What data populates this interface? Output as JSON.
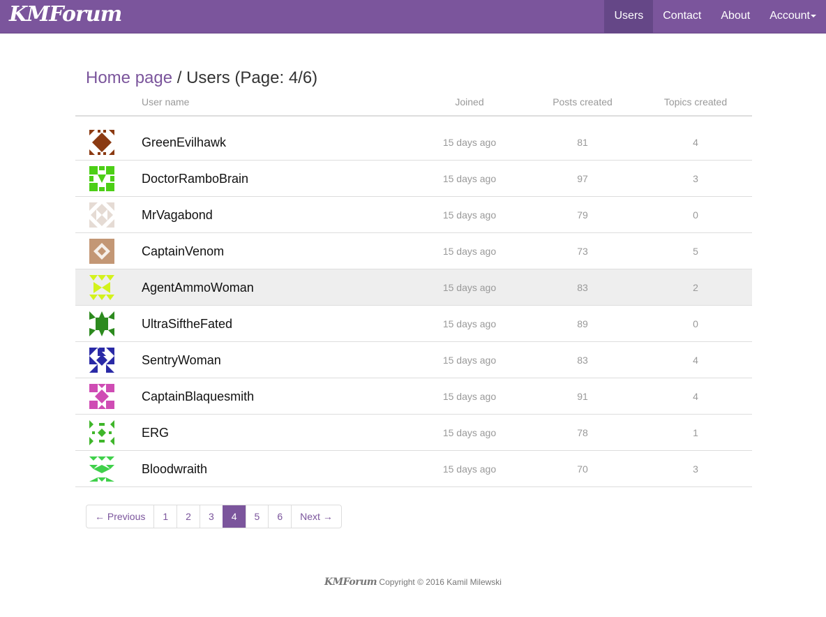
{
  "navbar": {
    "brand": "KMForum",
    "items": [
      {
        "label": "Users",
        "active": true
      },
      {
        "label": "Contact",
        "active": false
      },
      {
        "label": "About",
        "active": false
      },
      {
        "label": "Account",
        "active": false
      }
    ]
  },
  "breadcrumb": {
    "home": "Home page",
    "separator": " / ",
    "current": "Users (Page: 4/6)"
  },
  "table": {
    "headers": {
      "user_name": "User name",
      "joined": "Joined",
      "posts": "Posts created",
      "topics": "Topics created"
    },
    "rows": [
      {
        "name": "GreenEvilhawk",
        "joined": "15 days ago",
        "posts": "81",
        "topics": "4",
        "color": "#8b3a12"
      },
      {
        "name": "DoctorRamboBrain",
        "joined": "15 days ago",
        "posts": "97",
        "topics": "3",
        "color": "#4ccf16"
      },
      {
        "name": "MrVagabond",
        "joined": "15 days ago",
        "posts": "79",
        "topics": "0",
        "color": "#e5dbd4"
      },
      {
        "name": "CaptainVenom",
        "joined": "15 days ago",
        "posts": "73",
        "topics": "5",
        "color": "#c39775"
      },
      {
        "name": "AgentAmmoWoman",
        "joined": "15 days ago",
        "posts": "83",
        "topics": "2",
        "color": "#d3f21c"
      },
      {
        "name": "UltraSiftheFated",
        "joined": "15 days ago",
        "posts": "89",
        "topics": "0",
        "color": "#2c8a1e"
      },
      {
        "name": "SentryWoman",
        "joined": "15 days ago",
        "posts": "83",
        "topics": "4",
        "color": "#2a2aa6"
      },
      {
        "name": "CaptainBlaquesmith",
        "joined": "15 days ago",
        "posts": "91",
        "topics": "4",
        "color": "#cf4cb4"
      },
      {
        "name": "ERG",
        "joined": "15 days ago",
        "posts": "78",
        "topics": "1",
        "color": "#3fb62a"
      },
      {
        "name": "Bloodwraith",
        "joined": "15 days ago",
        "posts": "70",
        "topics": "3",
        "color": "#3fd04a"
      }
    ]
  },
  "pagination": {
    "previous": "← Previous",
    "pages": [
      "1",
      "2",
      "3",
      "4",
      "5",
      "6"
    ],
    "active_page": "4",
    "next": "Next →"
  },
  "footer": {
    "brand": "KMForum",
    "text": "Copyright © 2016 Kamil Milewski"
  },
  "colors": {
    "accent": "#7b559c",
    "nav_active": "#654787"
  }
}
